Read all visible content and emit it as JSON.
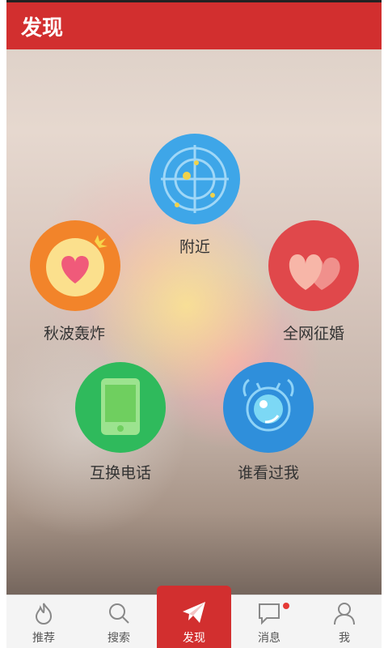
{
  "header": {
    "title": "发现"
  },
  "features": [
    {
      "id": "nearby",
      "label": "附近",
      "icon": "radar-icon",
      "color": "#3ea6e8"
    },
    {
      "id": "autumn",
      "label": "秋波轰炸",
      "icon": "heart-bomb-icon",
      "color": "#f2842a"
    },
    {
      "id": "marriage",
      "label": "全网征婚",
      "icon": "double-heart-icon",
      "color": "#e0484b"
    },
    {
      "id": "swap",
      "label": "互换电话",
      "icon": "phone-icon",
      "color": "#2fba5c"
    },
    {
      "id": "viewers",
      "label": "谁看过我",
      "icon": "eye-icon",
      "color": "#2f8fdb"
    }
  ],
  "tabs": [
    {
      "label": "推荐",
      "icon": "flame-icon",
      "active": false
    },
    {
      "label": "搜索",
      "icon": "search-icon",
      "active": false
    },
    {
      "label": "发现",
      "icon": "paper-plane-icon",
      "active": true
    },
    {
      "label": "消息",
      "icon": "chat-bubble-icon",
      "active": false,
      "badge": true
    },
    {
      "label": "我",
      "icon": "person-icon",
      "active": false
    }
  ],
  "colors": {
    "brand": "#d22f2f"
  }
}
